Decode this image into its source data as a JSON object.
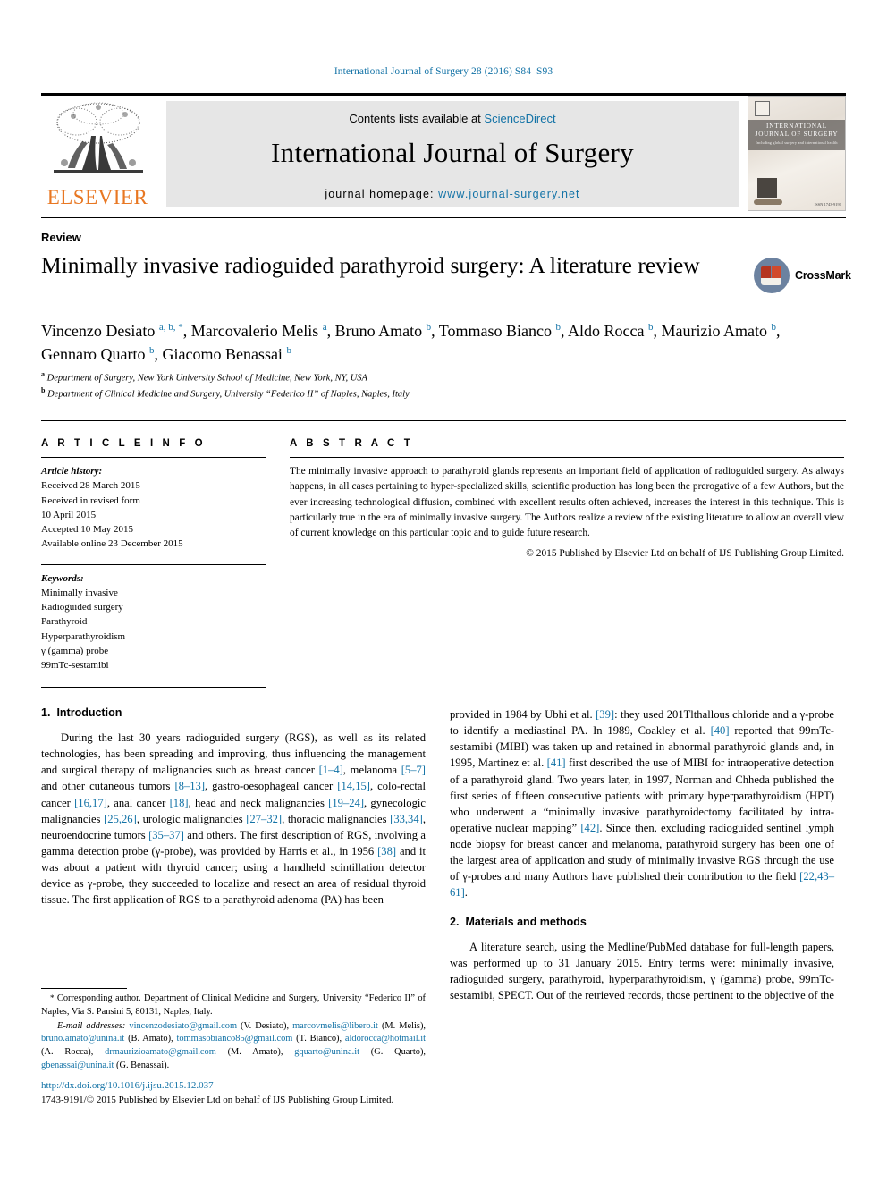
{
  "running_head": "International Journal of Surgery 28 (2016) S84–S93",
  "masthead": {
    "contents_prefix": "Contents lists available at ",
    "sciencedirect": "ScienceDirect",
    "journal_title": "International Journal of Surgery",
    "homepage_prefix": "journal homepage: ",
    "homepage_url": "www.journal-surgery.net",
    "publisher_logo_text": "ELSEVIER",
    "cover": {
      "title_line1": "INTERNATIONAL",
      "title_line2": "JOURNAL OF SURGERY",
      "subtitle": "Including global surgery and international health",
      "issn": "ISSN 1743-9191"
    }
  },
  "article": {
    "kind": "Review",
    "title": "Minimally invasive radioguided parathyroid surgery: A literature review",
    "crossmark_label": "CrossMark",
    "authors_html": "Vincenzo Desiato <sup>a, b, *</sup>, Marcovalerio Melis <sup>a</sup>, Bruno Amato <sup>b</sup>, Tommaso Bianco <sup>b</sup>, Aldo Rocca <sup>b</sup>, Maurizio Amato <sup>b</sup>, Gennaro Quarto <sup>b</sup>, Giacomo Benassai <sup>b</sup>",
    "affiliations_html": "<sup>a</sup> Department of Surgery, New York University School of Medicine, New York, NY, USA<br><sup>b</sup> Department of Clinical Medicine and Surgery, University “Federico II” of Naples, Naples, Italy"
  },
  "article_info": {
    "heading": "A R T I C L E   I N F O",
    "history_label": "Article history:",
    "history": [
      "Received 28 March 2015",
      "Received in revised form",
      "10 April 2015",
      "Accepted 10 May 2015",
      "Available online 23 December 2015"
    ],
    "keywords_label": "Keywords:",
    "keywords": [
      "Minimally invasive",
      "Radioguided surgery",
      "Parathyroid",
      "Hyperparathyroidism",
      "γ (gamma) probe",
      "99mTc-sestamibi"
    ]
  },
  "abstract": {
    "heading": "A B S T R A C T",
    "body": "The minimally invasive approach to parathyroid glands represents an important field of application of radioguided surgery. As always happens, in all cases pertaining to hyper-specialized skills, scientific production has long been the prerogative of a few Authors, but the ever increasing technological diffusion, combined with excellent results often achieved, increases the interest in this technique. This is particularly true in the era of minimally invasive surgery. The Authors realize a review of the existing literature to allow an overall view of current knowledge on this particular topic and to guide future research.",
    "copyright": "© 2015 Published by Elsevier Ltd on behalf of IJS Publishing Group Limited."
  },
  "body": {
    "section1": {
      "number": "1.",
      "title": "Introduction",
      "paragraph_html": "During the last 30 years radioguided surgery (RGS), as well as its related technologies, has been spreading and improving, thus influencing the management and surgical therapy of malignancies such as breast cancer <span class=\"ref\">[1&ndash;4]</span>, melanoma <span class=\"ref\">[5&ndash;7]</span> and other cutaneous tumors <span class=\"ref\">[8&ndash;13]</span>, gastro-oesophageal cancer <span class=\"ref\">[14,15]</span>, colo-rectal cancer <span class=\"ref\">[16,17]</span>, anal cancer <span class=\"ref\">[18]</span>, head and neck malignancies <span class=\"ref\">[19&ndash;24]</span>, gynecologic malignancies <span class=\"ref\">[25,26]</span>, urologic malignancies <span class=\"ref\">[27&ndash;32]</span>, thoracic malignancies <span class=\"ref\">[33,34]</span>, neuroendocrine tumors <span class=\"ref\">[35&ndash;37]</span> and others. The first description of RGS, involving a gamma detection probe (&gamma;-probe), was provided by Harris et al., in 1956 <span class=\"ref\">[38]</span> and it was about a patient with thyroid cancer; using a handheld scintillation detector device as &gamma;-probe, they succeeded to localize and resect an area of residual thyroid tissue. The first application of RGS to a parathyroid adenoma (PA) has been"
    },
    "section1_cont": {
      "paragraph_html": "provided in 1984 by Ubhi et al. <span class=\"ref\">[39]</span>: they used 201Tlthallous chloride and a &gamma;-probe to identify a mediastinal PA. In 1989, Coakley et al. <span class=\"ref\">[40]</span> reported that 99mTc-sestamibi (MIBI) was taken up and retained in abnormal parathyroid glands and, in 1995, Martinez et al. <span class=\"ref\">[41]</span> first described the use of MIBI for intraoperative detection of a parathyroid gland. Two years later, in 1997, Norman and Chheda published the first series of fifteen consecutive patients with primary hyperparathyroidism (HPT) who underwent a &ldquo;minimally invasive parathyroidectomy facilitated by intra-operative nuclear mapping&rdquo; <span class=\"ref\">[42]</span>. Since then, excluding radioguided sentinel lymph node biopsy for breast cancer and melanoma, parathyroid surgery has been one of the largest area of application and study of minimally invasive RGS through the use of &gamma;-probes and many Authors have published their contribution to the field <span class=\"ref\">[22,43&ndash;61]</span>."
    },
    "section2": {
      "number": "2.",
      "title": "Materials and methods",
      "paragraph_html": "A literature search, using the Medline/PubMed database for full-length papers, was performed up to 31 January 2015. Entry terms were: minimally invasive, radioguided surgery, parathyroid, hyperparathyroidism, &gamma; (gamma) probe, 99mTc-sestamibi, SPECT. Out of the retrieved records, those pertinent to the objective of the"
    }
  },
  "footnotes": {
    "corresponding_html": "<span class=\"star\">*</span> Corresponding author. Department of Clinical Medicine and Surgery, University &ldquo;Federico II&rdquo; of Naples, Via S. Pansini 5, 80131, Naples, Italy.",
    "emails_html": "<span class=\"emaillbl\"><i>E-mail addresses:</i></span> <span class=\"mail\">vincenzodesiato@gmail.com</span> (V. Desiato), <span class=\"mail\">marcovmelis@libero.it</span> (M. Melis), <span class=\"mail\">bruno.amato@unina.it</span> (B. Amato), <span class=\"mail\">tommasobianco85@gmail.com</span> (T. Bianco), <span class=\"mail\">aldorocca@hotmail.it</span> (A. Rocca), <span class=\"mail\">drmaurizioamato@gmail.com</span> (M. Amato), <span class=\"mail\">gquarto@unina.it</span> (G. Quarto), <span class=\"mail\">gbenassai@unina.it</span> (G. Benassai).",
    "doi": "http://dx.doi.org/10.1016/j.ijsu.2015.12.037",
    "issn_line": "1743-9191/© 2015 Published by Elsevier Ltd on behalf of IJS Publishing Group Limited."
  },
  "colors": {
    "link": "#1272a6",
    "elsevier_orange": "#E87722",
    "band_gray": "#e6e6e6"
  }
}
